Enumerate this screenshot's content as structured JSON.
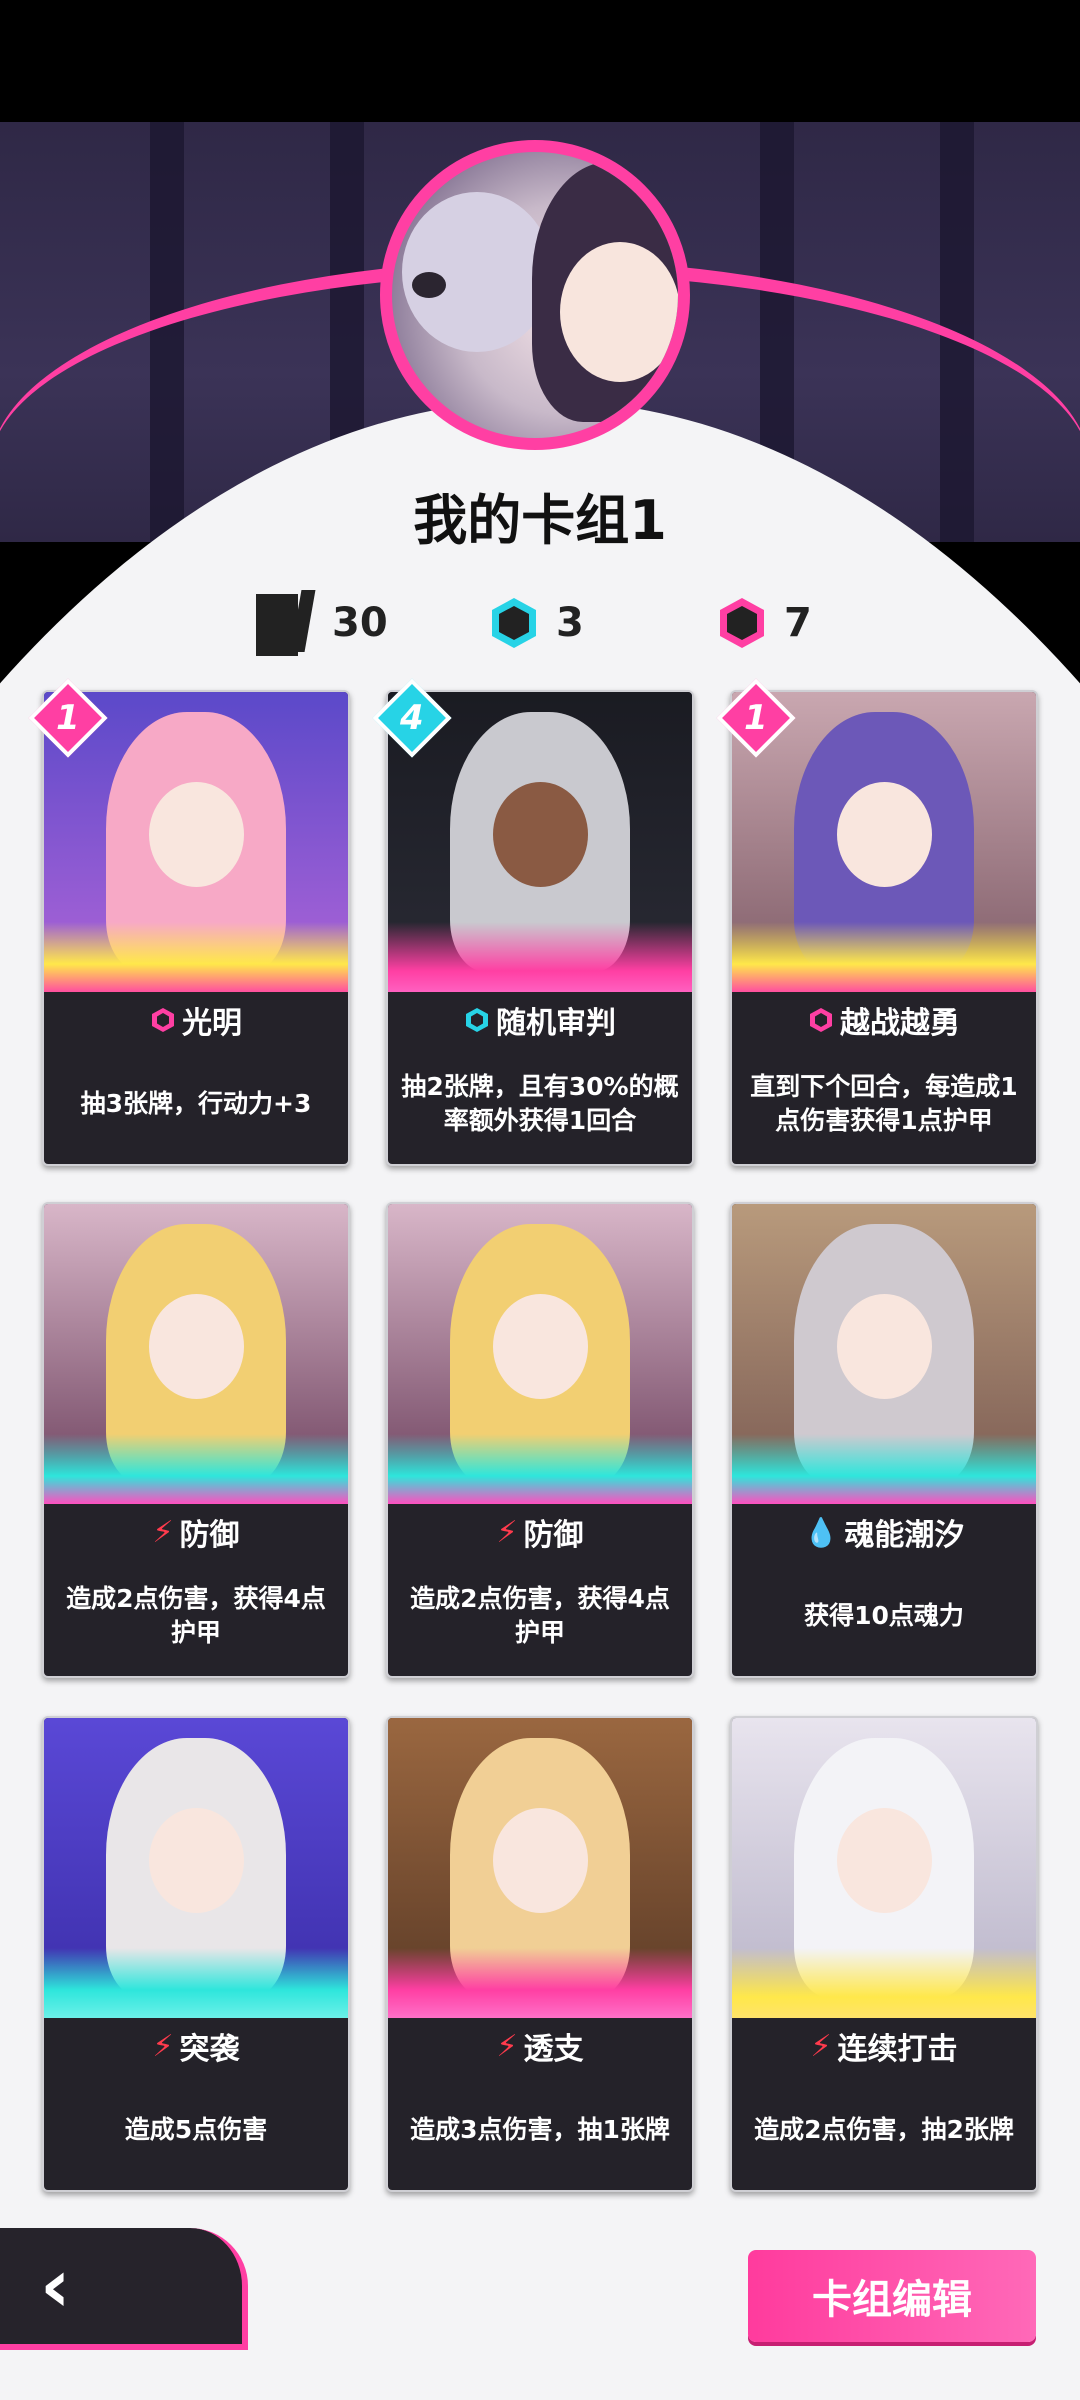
{
  "deck": {
    "title": "我的卡组1",
    "stats": {
      "cards": "30",
      "cyan": "3",
      "pink": "7"
    }
  },
  "cards": [
    {
      "name": "光明",
      "desc": "抽3张牌，行动力+3",
      "cost": "1",
      "type": "hex-pink-icon"
    },
    {
      "name": "随机审判",
      "desc": "抽2张牌，且有30%的概率额外获得1回合",
      "cost": "4",
      "type": "hex-cyan-icon"
    },
    {
      "name": "越战越勇",
      "desc": "直到下个回合，每造成1点伤害获得1点护甲",
      "cost": "1",
      "type": "hex-pink-icon"
    },
    {
      "name": "防御",
      "desc": "造成2点伤害，获得4点护甲",
      "cost": "",
      "type": "bolt-icon"
    },
    {
      "name": "防御",
      "desc": "造成2点伤害，获得4点护甲",
      "cost": "",
      "type": "bolt-icon"
    },
    {
      "name": "魂能潮汐",
      "desc": "获得10点魂力",
      "cost": "",
      "type": "drop-icon"
    },
    {
      "name": "突袭",
      "desc": "造成5点伤害",
      "cost": "",
      "type": "bolt-icon"
    },
    {
      "name": "透支",
      "desc": "造成3点伤害，抽1张牌",
      "cost": "",
      "type": "bolt-icon"
    },
    {
      "name": "连续打击",
      "desc": "造成2点伤害，抽2张牌",
      "cost": "",
      "type": "bolt-icon"
    }
  ],
  "buttons": {
    "back": "‹",
    "edit": "卡组编辑"
  },
  "colors": {
    "accent": "#ff3fa3",
    "cyan": "#27d3e6",
    "cardBg": "#242229"
  }
}
